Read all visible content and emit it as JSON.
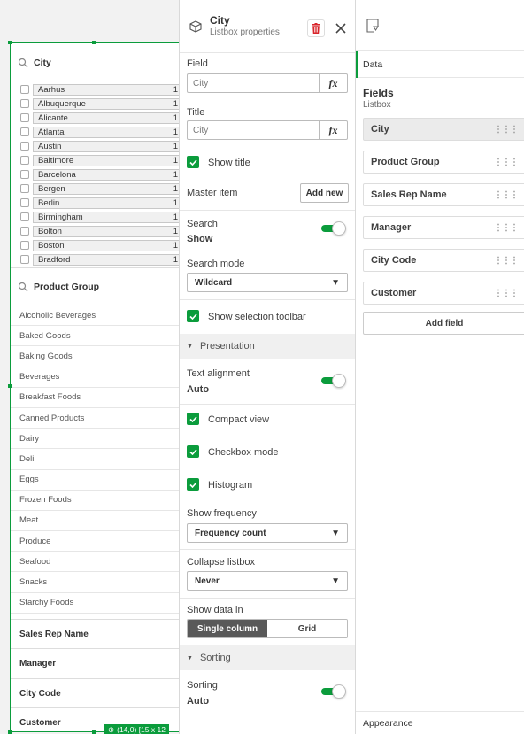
{
  "canvas": {
    "city_listbox": {
      "title": "City",
      "items": [
        {
          "name": "Aarhus",
          "count": "1"
        },
        {
          "name": "Albuquerque",
          "count": "1"
        },
        {
          "name": "Alicante",
          "count": "1"
        },
        {
          "name": "Atlanta",
          "count": "1"
        },
        {
          "name": "Austin",
          "count": "1"
        },
        {
          "name": "Baltimore",
          "count": "1"
        },
        {
          "name": "Barcelona",
          "count": "1"
        },
        {
          "name": "Bergen",
          "count": "1"
        },
        {
          "name": "Berlin",
          "count": "1"
        },
        {
          "name": "Birmingham",
          "count": "1"
        },
        {
          "name": "Bolton",
          "count": "1"
        },
        {
          "name": "Boston",
          "count": "1"
        },
        {
          "name": "Bradford",
          "count": "1"
        }
      ]
    },
    "product_group_listbox": {
      "title": "Product Group",
      "items": [
        "Alcoholic Beverages",
        "Baked Goods",
        "Baking Goods",
        "Beverages",
        "Breakfast Foods",
        "Canned Products",
        "Dairy",
        "Deli",
        "Eggs",
        "Frozen Foods",
        "Meat",
        "Produce",
        "Seafood",
        "Snacks",
        "Starchy Foods"
      ]
    },
    "collapsed_listboxes": [
      "Sales Rep Name",
      "Manager",
      "City Code",
      "Customer"
    ],
    "size_badge": "(14,0) [15 x 12"
  },
  "properties": {
    "title": "City",
    "subtitle": "Listbox properties",
    "field_label": "Field",
    "field_value": "City",
    "title_label": "Title",
    "title_value": "City",
    "fx_label": "fx",
    "show_title_label": "Show title",
    "master_item_label": "Master item",
    "add_new_label": "Add new",
    "search_label": "Search",
    "search_value": "Show",
    "search_mode_label": "Search mode",
    "search_mode_value": "Wildcard",
    "show_selection_toolbar_label": "Show selection toolbar",
    "presentation_label": "Presentation",
    "text_alignment_label": "Text alignment",
    "text_alignment_value": "Auto",
    "compact_view_label": "Compact view",
    "checkbox_mode_label": "Checkbox mode",
    "histogram_label": "Histogram",
    "show_frequency_label": "Show frequency",
    "show_frequency_value": "Frequency count",
    "collapse_listbox_label": "Collapse listbox",
    "collapse_listbox_value": "Never",
    "show_data_in_label": "Show data in",
    "single_column_label": "Single column",
    "grid_label": "Grid",
    "sorting_section_label": "Sorting",
    "sorting_label": "Sorting",
    "sorting_value": "Auto"
  },
  "data_panel": {
    "tab_label": "Data",
    "fields_title": "Fields",
    "fields_subtitle": "Listbox",
    "fields": [
      "City",
      "Product Group",
      "Sales Rep Name",
      "Manager",
      "City Code",
      "Customer"
    ],
    "add_field_label": "Add field",
    "appearance_label": "Appearance"
  },
  "colors": {
    "accent": "#0b9c3c",
    "delete_red": "#d9262c"
  }
}
